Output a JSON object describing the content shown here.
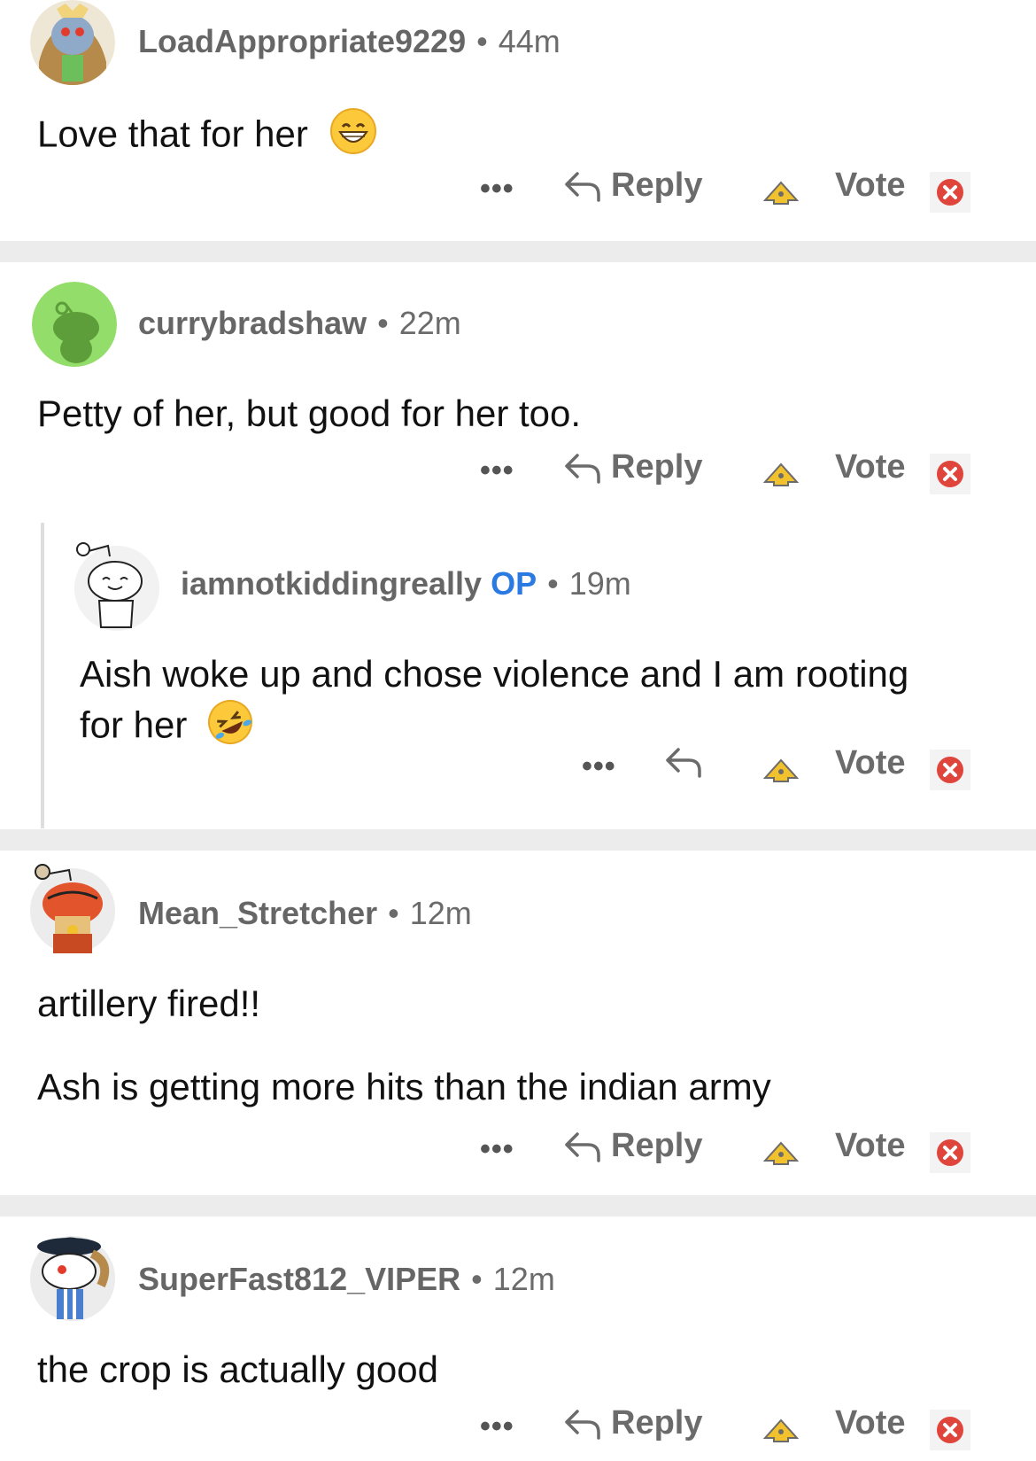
{
  "comments": [
    {
      "username": "LoadAppropriate9229",
      "time": "44m",
      "body": "Love that for her",
      "emoji": "grinning-face",
      "reply_label": "Reply",
      "vote_label": "Vote",
      "more": "•••"
    },
    {
      "username": "currybradshaw",
      "time": "22m",
      "body": "Petty of her, but good for her too.",
      "reply_label": "Reply",
      "vote_label": "Vote",
      "more": "•••"
    },
    {
      "username": "iamnotkiddingreally",
      "op_badge": "OP",
      "time": "19m",
      "body_line1": "Aish woke up and chose violence and I am rooting",
      "body_line2": "for her",
      "emoji": "rolling-on-floor-laughing",
      "vote_label": "Vote",
      "more": "•••"
    },
    {
      "username": "Mean_Stretcher",
      "time": "12m",
      "body_line1": "artillery fired!!",
      "body_line2": "Ash is getting more hits than the indian army",
      "reply_label": "Reply",
      "vote_label": "Vote",
      "more": "•••"
    },
    {
      "username": "SuperFast812_VIPER",
      "time": "12m",
      "body": "the crop is actually good",
      "reply_label": "Reply",
      "vote_label": "Vote",
      "more": "•••"
    }
  ],
  "separator": "•",
  "colors": {
    "op": "#2a7ae2",
    "meta": "#6b6b6b",
    "divider": "#ececec",
    "downvote": "#e0453c",
    "upvote": "#f2c12e"
  },
  "icons": [
    "reply-arrow-icon",
    "upvote-icon",
    "downvote-icon",
    "more-options-icon"
  ]
}
